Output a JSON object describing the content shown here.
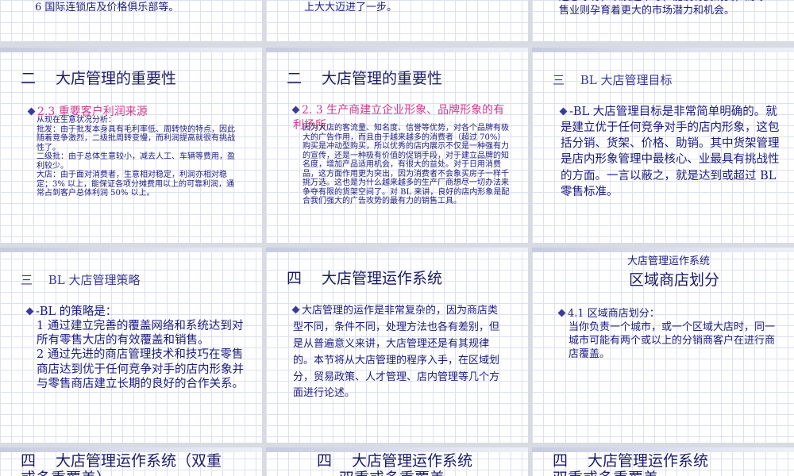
{
  "slides": {
    "s1": {
      "text": "6 国际连锁店及价格俱乐部等。"
    },
    "s2": {
      "text": "上大大迈进了一步。"
    },
    "s3": {
      "text": "还忽冰有，以及超市等，能没有要消费，而零\n售业则孕育着更大的市场潜力和机会。"
    },
    "s4": {
      "title": "二　 大店管理的重要性",
      "subtitle": "2.3  重要客户利润来源",
      "body": "从现在生意状况分析：\n批发：由于批发本身具有毛利率低、周转快的特点，因此随着竞争激烈，二级批周转变慢，而利润提高就很有挑战性了。\n二级批：由于总体生意较小，减去人工、车辆等费用，盈利较少。\n大店：由于面对消费者，生意相对稳定，利润亦相对稳定；3% 以上，能保证各项分摊费用以上的可靠利润，通常占到客户总体利润 50% 以上。"
    },
    "s5": {
      "title": "二　 大店管理的重要性",
      "subtitle": "2. 3 生产商建立企业形象、品牌形象的有利场所",
      "body": "因为大店的客流量、知名度、信誉等优势，对各个品牌有极大的广告作用，而且由于越来越多的消费者（超过 70%）购买是冲动型购买，所以优秀的店内展示不仅是一种强有力的宣传，还是一种极有价值的促销手段，对于建立品牌的知名度，增加产品适用机会，有很大的益处。对于日用消费品，这方面作用更为突出，因为消费者不会象买房子一样千挑万选。这也是为什么越来越多的生产厂商想尽一切办法来争夺有限的货架空间了。对 BL 来讲，良好的店内形象是配合我们强大的广告攻势的最有力的销售工具。"
    },
    "s6": {
      "title": "三　 BL 大店管理目标",
      "body": "-BL 大店管理目标是非常简单明确的。就是建立优于任何竞争对手的店内形象，这包括分销、货架、价格、助销。其中货架管理是店内形象管理中最核心、业最具有挑战性的方面。一言以蔽之，就是达到或超过 BL 零售标准。"
    },
    "s7": {
      "title": "三　 BL 大店管理策略",
      "lines": [
        "-BL 的策略是：",
        "1 通过建立完善的覆盖网络和系统达到对所有零售大店的有效覆盖和销售。",
        "2 通过先进的商店管理技术和技巧在零售商店达到优于任何竞争对手的店内形象并与零售商店建立长期的良好的合作关系。"
      ]
    },
    "s8": {
      "title": "四　 大店管理运作系统",
      "body": "大店管理的运作是非常复杂的，因为商店类型不同，条件不同，处理方法也各有差别，但是从普遍意义来讲，大店管理还是有其规律的。本节将从大店管理的程序入手，在区域划分，贸易政策、人才管理、店内管理等几个方面进行论述。"
    },
    "s9": {
      "title_small": "大店管理运作系统",
      "title": "区域商店划分",
      "lead": "4.1 区域商店划分：",
      "body": "当你负责一个城市，或一个区域大店时，同一城市可能有两个或以上的分销商客户在进行商店覆盖。"
    },
    "s10": {
      "title": "四　 大店管理运作系统（双重",
      "line2": "或多重覆盖）"
    },
    "s11": {
      "title": "四　 大店管理运作系统",
      "line2": "双重或多重覆盖"
    },
    "s12": {
      "title": "四　 大店管理运作系统",
      "line2": "双重或多重覆盖"
    }
  }
}
